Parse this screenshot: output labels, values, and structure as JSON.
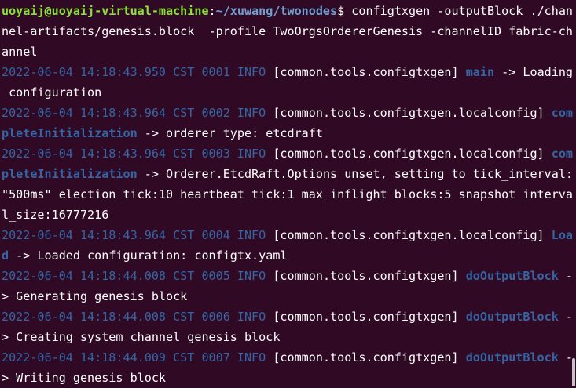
{
  "prompt": {
    "user_host": "uoyaij@uoyaij-virtual-machine",
    "colon": ":",
    "path": "~/xuwang/twonodes",
    "dollar": "$ ",
    "command_1": "configtxgen -outputBlock ./chan",
    "command_2": "nel-artifacts/genesis.block  -profile TwoOrgsOrdererGenesis -channelID fabric-ch",
    "command_3": "annel"
  },
  "logs": [
    {
      "meta": "2022-06-04 14:18:43.950 CST 0001 INFO ",
      "module": "[common.tools.configtxgen] ",
      "fn_a": "main",
      "rest_a": " -> Loading",
      "fn_b": "",
      "rest_b": " configuration",
      "rest_c": ""
    },
    {
      "meta": "2022-06-04 14:18:43.964 CST 0002 INFO ",
      "module": "[common.tools.configtxgen.localconfig] ",
      "fn_a": "com",
      "rest_a": "",
      "fn_b": "pleteInitialization",
      "rest_b": " -> orderer type: etcdraft",
      "rest_c": ""
    },
    {
      "meta": "2022-06-04 14:18:43.964 CST 0003 INFO ",
      "module": "[common.tools.configtxgen.localconfig] ",
      "fn_a": "com",
      "rest_a": "",
      "fn_b": "pleteInitialization",
      "rest_b": " -> Orderer.EtcdRaft.Options unset, setting to tick_interval:",
      "rest_c": "\"500ms\" election_tick:10 heartbeat_tick:1 max_inflight_blocks:5 snapshot_interva",
      "rest_d": "l_size:16777216"
    },
    {
      "meta": "2022-06-04 14:18:43.964 CST 0004 INFO ",
      "module": "[common.tools.configtxgen.localconfig] ",
      "fn_a": "Loa",
      "rest_a": "",
      "fn_b": "d",
      "rest_b": " -> Loaded configuration: configtx.yaml",
      "rest_c": ""
    },
    {
      "meta": "2022-06-04 14:18:44.008 CST 0005 INFO ",
      "module": "[common.tools.configtxgen] ",
      "fn_a": "doOutputBlock",
      "rest_a": " -",
      "fn_b": "",
      "rest_b": "> Generating genesis block",
      "rest_c": ""
    },
    {
      "meta": "2022-06-04 14:18:44.008 CST 0006 INFO ",
      "module": "[common.tools.configtxgen] ",
      "fn_a": "doOutputBlock",
      "rest_a": " -",
      "fn_b": "",
      "rest_b": "> Creating system channel genesis block",
      "rest_c": ""
    },
    {
      "meta": "2022-06-04 14:18:44.009 CST 0007 INFO ",
      "module": "[common.tools.configtxgen] ",
      "fn_a": "doOutputBlock",
      "rest_a": " -",
      "fn_b": "",
      "rest_b": "> Writing genesis block",
      "rest_c": ""
    }
  ],
  "colors": {
    "background": "#300a24",
    "prompt_user": "#8ae234",
    "prompt_path": "#729fcf",
    "log_meta": "#3465a4"
  }
}
